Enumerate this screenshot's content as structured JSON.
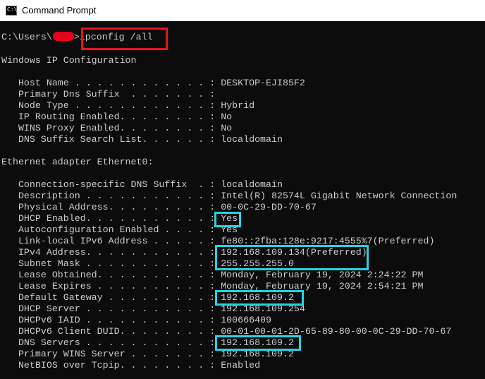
{
  "window": {
    "title": "Command Prompt",
    "icon": "cmd-icon",
    "icon_glyph": "C:\\"
  },
  "colors": {
    "console_background": "#0c0c0c",
    "console_text": "#cccccc",
    "highlight_cyan": "#27d3e0",
    "highlight_red": "#e8141c",
    "redaction": "#e8001c"
  },
  "prompt": {
    "path_prefix": "C:\\Users\\",
    "path_suffix": ">",
    "command": "ipconfig /all"
  },
  "header": "Windows IP Configuration",
  "global_config": [
    {
      "label": "   Host Name . . . . . . . . . . . . : ",
      "value": "DESKTOP-EJI85F2"
    },
    {
      "label": "   Primary Dns Suffix  . . . . . . . : ",
      "value": ""
    },
    {
      "label": "   Node Type . . . . . . . . . . . . : ",
      "value": "Hybrid"
    },
    {
      "label": "   IP Routing Enabled. . . . . . . . : ",
      "value": "No"
    },
    {
      "label": "   WINS Proxy Enabled. . . . . . . . : ",
      "value": "No"
    },
    {
      "label": "   DNS Suffix Search List. . . . . . : ",
      "value": "localdomain"
    }
  ],
  "adapter_header": "Ethernet adapter Ethernet0:",
  "adapter_config": [
    {
      "label": "   Connection-specific DNS Suffix  . : ",
      "value": "localdomain"
    },
    {
      "label": "   Description . . . . . . . . . . . : ",
      "value": "Intel(R) 82574L Gigabit Network Connection"
    },
    {
      "label": "   Physical Address. . . . . . . . . : ",
      "value": "00-0C-29-DD-70-67"
    },
    {
      "label": "   DHCP Enabled. . . . . . . . . . . : ",
      "value": "Yes"
    },
    {
      "label": "   Autoconfiguration Enabled . . . . : ",
      "value": "Yes"
    },
    {
      "label": "   Link-local IPv6 Address . . . . . : ",
      "value": "fe80::2fba:128e:9217:4555%7(Preferred)"
    },
    {
      "label": "   IPv4 Address. . . . . . . . . . . : ",
      "value": "192.168.109.134(Preferred)"
    },
    {
      "label": "   Subnet Mask . . . . . . . . . . . : ",
      "value": "255.255.255.0"
    },
    {
      "label": "   Lease Obtained. . . . . . . . . . : ",
      "value": "Monday, February 19, 2024 2:24:22 PM"
    },
    {
      "label": "   Lease Expires . . . . . . . . . . : ",
      "value": "Monday, February 19, 2024 2:54:21 PM"
    },
    {
      "label": "   Default Gateway . . . . . . . . . : ",
      "value": "192.168.109.2"
    },
    {
      "label": "   DHCP Server . . . . . . . . . . . : ",
      "value": "192.168.109.254"
    },
    {
      "label": "   DHCPv6 IAID . . . . . . . . . . . : ",
      "value": "100666409"
    },
    {
      "label": "   DHCPv6 Client DUID. . . . . . . . : ",
      "value": "00-01-00-01-2D-65-89-80-00-0C-29-DD-70-67"
    },
    {
      "label": "   DNS Servers . . . . . . . . . . . : ",
      "value": "192.168.109.2"
    },
    {
      "label": "   Primary WINS Server . . . . . . . : ",
      "value": "192.168.109.2"
    },
    {
      "label": "   NetBIOS over Tcpip. . . . . . . . : ",
      "value": "Enabled"
    }
  ]
}
